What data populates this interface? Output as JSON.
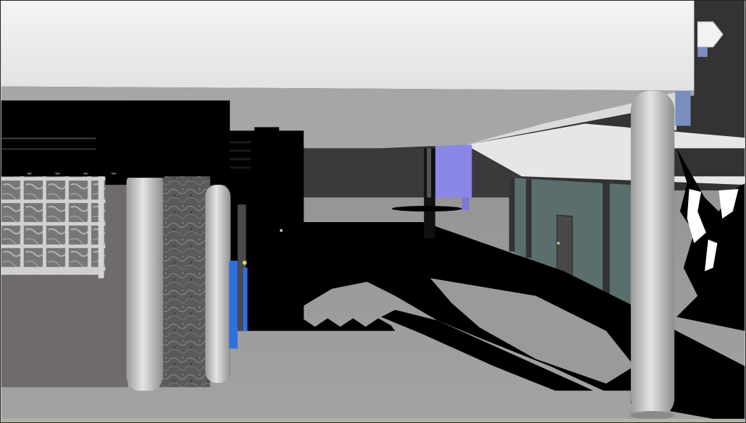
{
  "scene": {
    "description_visible_text": "",
    "colors": {
      "sky_dark": "#333333",
      "canopy_underside": "#efefef",
      "canopy_edge": "#d9d9d9",
      "ground": "#9a9a9a",
      "ground_light": "#a6a6a6",
      "shadow": "#000000",
      "wall_gray": "#6e6a6e",
      "pillar_light": "#d8d8d8",
      "pillar_shade": "#9c9c9c",
      "marble": "#5b5b5b",
      "blue_door": "#2f6fe0",
      "purple_panel": "#8a87e6",
      "teal_wall": "#5b6e6e",
      "dark_door": "#4a4747"
    }
  }
}
